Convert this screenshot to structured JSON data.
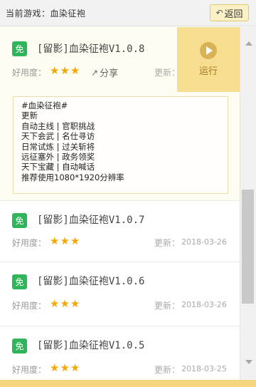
{
  "header": {
    "title": "当前游戏：血染征袍",
    "back_label": "返回"
  },
  "rating_label": "好用度：",
  "share_label": "分享",
  "update_label": "更新：",
  "run_label": "运行",
  "badge_label": "免",
  "items": [
    {
      "title": "[留影]血染征袍V1.0.8",
      "rating": 3,
      "stars": "★★★",
      "date": "",
      "description": [
        "#血染征袍#",
        "更新",
        "自动主线 | 官职挑战",
        "天下会武 | 名仕寻访",
        "日常试炼 | 过关斩将",
        "远征塞外 | 政务领奖",
        "天下宝藏 | 自动喊话",
        "推荐使用1080*1920分辨率"
      ]
    },
    {
      "title": "[留影]血染征袍V1.0.7",
      "rating": 3,
      "stars": "★★★",
      "date": "2018-03-26"
    },
    {
      "title": "[留影]血染征袍V1.0.6",
      "rating": 3,
      "stars": "★★★",
      "date": "2018-03-26"
    },
    {
      "title": "[留影]血染征袍V1.0.5",
      "rating": 3,
      "stars": "★★★",
      "date": "2018-03-25"
    }
  ],
  "icons": {
    "back": "back-arrow-icon",
    "share": "share-icon",
    "run": "play-icon"
  },
  "colors": {
    "badge": "#2fb55a",
    "run_button": "#f7dd8f",
    "star": "#f5a800"
  }
}
